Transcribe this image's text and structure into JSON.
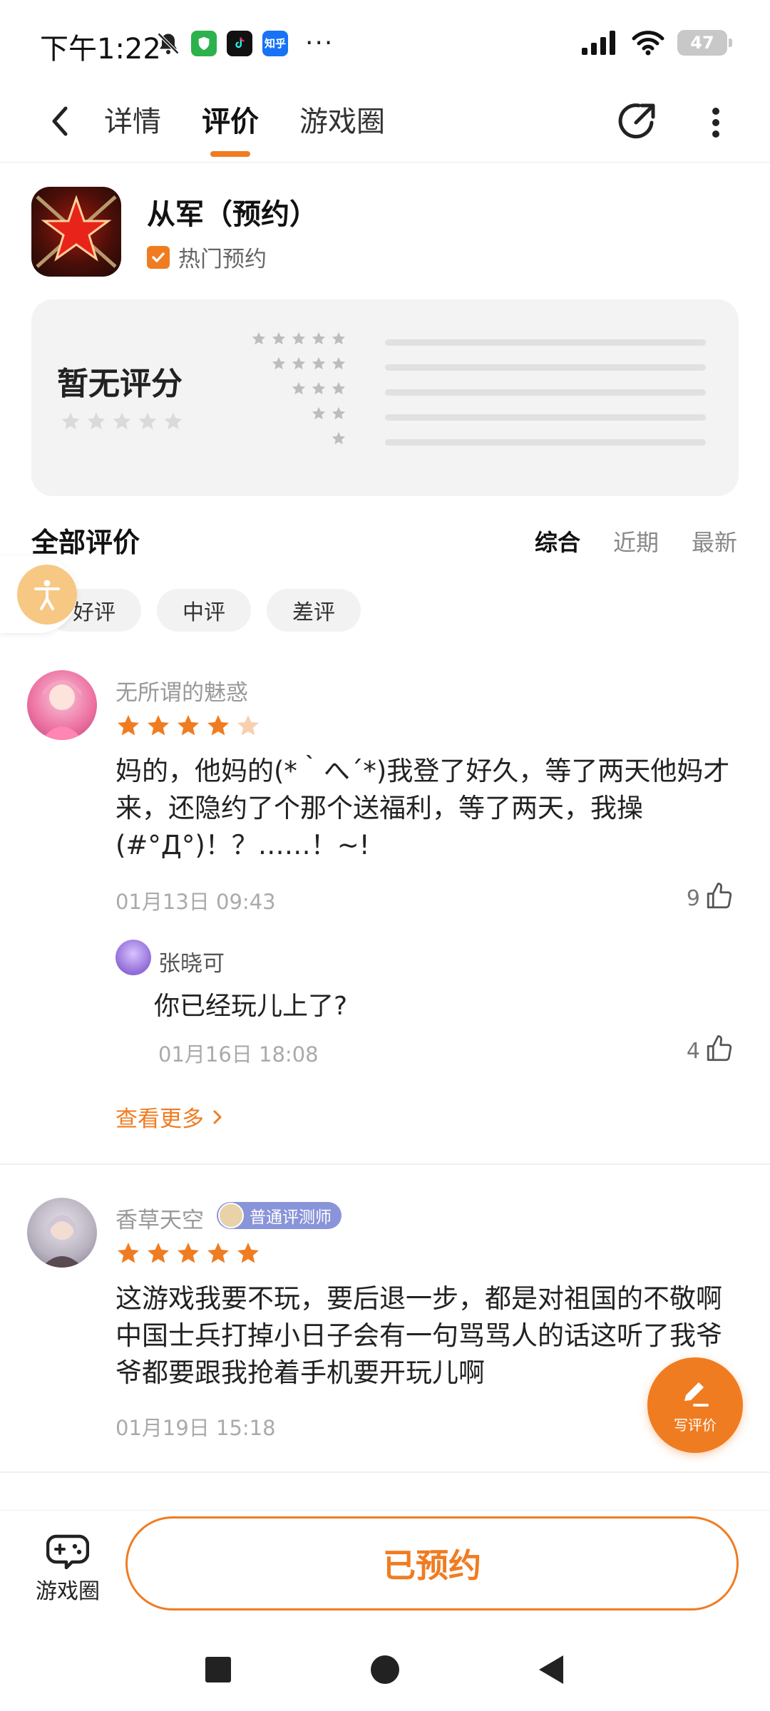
{
  "status_bar": {
    "time": "下午1:22",
    "notif_app_3_label": "知乎",
    "more": "···",
    "battery": "47"
  },
  "nav": {
    "tabs": [
      {
        "label": "详情"
      },
      {
        "label": "评价"
      },
      {
        "label": "游戏圈"
      }
    ],
    "active_tab": "评价"
  },
  "app": {
    "name": "从军（预约）",
    "badge": "热门预约"
  },
  "rating": {
    "no_score_text": "暂无评分",
    "distribution": [
      {
        "stars": 5,
        "fraction": 0
      },
      {
        "stars": 4,
        "fraction": 0
      },
      {
        "stars": 3,
        "fraction": 0
      },
      {
        "stars": 2,
        "fraction": 0
      },
      {
        "stars": 1,
        "fraction": 0
      }
    ]
  },
  "reviews_section": {
    "title": "全部评价",
    "sort_options": [
      "综合",
      "近期",
      "最新"
    ],
    "active_sort": "综合",
    "filters": [
      "好评",
      "中评",
      "差评"
    ]
  },
  "reviews": [
    {
      "user": "无所谓的魅惑",
      "rating": 4,
      "text": "妈的，他妈的(*｀へ´*)我登了好久，等了两天他妈才来，还隐约了个那个送福利，等了两天，我操(#°Д°)！？……！~!",
      "date": "01月13日 09:43",
      "likes": "9",
      "reply": {
        "user": "张晓可",
        "text": "你已经玩儿上了?",
        "date": "01月16日 18:08",
        "likes": "4"
      },
      "see_more": "查看更多"
    },
    {
      "user": "香草天空",
      "badge": "普通评测师",
      "rating": 5,
      "text": "这游戏我要不玩，要后退一步，都是对祖国的不敬啊中国士兵打掉小日子会有一句骂骂人的话这听了我爷爷都要跟我抢着手机要开玩儿啊",
      "date": "01月19日 15:18"
    }
  ],
  "write_review_label": "写评价",
  "bottom_bar": {
    "game_circle_label": "游戏圈",
    "action_label": "已预约"
  },
  "colors": {
    "accent": "#f07c21",
    "star_filled": "#f07c21",
    "star_empty": "#d6d6d6",
    "card_bg": "#f3f3f3"
  }
}
